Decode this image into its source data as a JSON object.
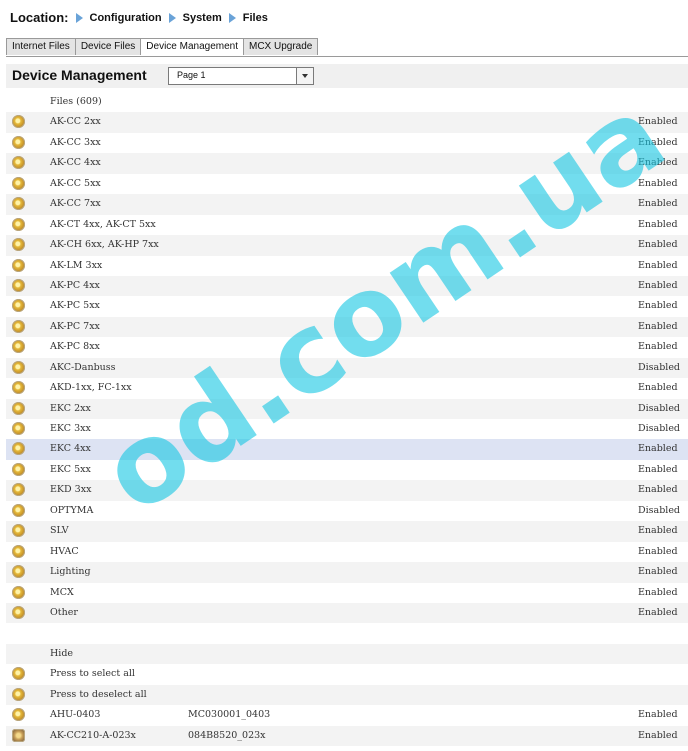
{
  "location": {
    "label": "Location:",
    "crumbs": [
      "Configuration",
      "System",
      "Files"
    ]
  },
  "tabs": [
    {
      "label": "Internet Files",
      "active": false
    },
    {
      "label": "Device Files",
      "active": false
    },
    {
      "label": "Device Management",
      "active": true
    },
    {
      "label": "MCX Upgrade",
      "active": false
    }
  ],
  "header": {
    "title": "Device Management",
    "page_select": "Page 1"
  },
  "rows": [
    {
      "icon": "",
      "name": "Files (609)",
      "code": "",
      "status": ""
    },
    {
      "icon": "gear-icon",
      "name": "AK-CC 2xx",
      "code": "",
      "status": "Enabled"
    },
    {
      "icon": "gear-icon",
      "name": "AK-CC 3xx",
      "code": "",
      "status": "Enabled"
    },
    {
      "icon": "gear-icon",
      "name": "AK-CC 4xx",
      "code": "",
      "status": "Enabled"
    },
    {
      "icon": "gear-icon",
      "name": "AK-CC 5xx",
      "code": "",
      "status": "Enabled"
    },
    {
      "icon": "gear-icon",
      "name": "AK-CC 7xx",
      "code": "",
      "status": "Enabled"
    },
    {
      "icon": "gear-icon",
      "name": "AK-CT 4xx, AK-CT 5xx",
      "code": "",
      "status": "Enabled"
    },
    {
      "icon": "gear-icon",
      "name": "AK-CH 6xx, AK-HP 7xx",
      "code": "",
      "status": "Enabled"
    },
    {
      "icon": "gear-icon",
      "name": "AK-LM 3xx",
      "code": "",
      "status": "Enabled"
    },
    {
      "icon": "gear-icon",
      "name": "AK-PC 4xx",
      "code": "",
      "status": "Enabled"
    },
    {
      "icon": "gear-icon",
      "name": "AK-PC 5xx",
      "code": "",
      "status": "Enabled"
    },
    {
      "icon": "gear-icon",
      "name": "AK-PC 7xx",
      "code": "",
      "status": "Enabled"
    },
    {
      "icon": "gear-icon",
      "name": "AK-PC 8xx",
      "code": "",
      "status": "Enabled"
    },
    {
      "icon": "gear-icon",
      "name": "AKC-Danbuss",
      "code": "",
      "status": "Disabled"
    },
    {
      "icon": "gear-icon",
      "name": "AKD-1xx, FC-1xx",
      "code": "",
      "status": "Enabled"
    },
    {
      "icon": "gear-icon",
      "name": "EKC 2xx",
      "code": "",
      "status": "Disabled"
    },
    {
      "icon": "gear-icon",
      "name": "EKC 3xx",
      "code": "",
      "status": "Disabled"
    },
    {
      "icon": "gear-icon",
      "name": "EKC 4xx",
      "code": "",
      "status": "Enabled",
      "highlight": true
    },
    {
      "icon": "gear-icon",
      "name": "EKC 5xx",
      "code": "",
      "status": "Enabled"
    },
    {
      "icon": "gear-icon",
      "name": "EKD 3xx",
      "code": "",
      "status": "Enabled"
    },
    {
      "icon": "gear-icon",
      "name": "OPTYMA",
      "code": "",
      "status": "Disabled"
    },
    {
      "icon": "gear-icon",
      "name": "SLV",
      "code": "",
      "status": "Enabled"
    },
    {
      "icon": "gear-icon",
      "name": "HVAC",
      "code": "",
      "status": "Enabled"
    },
    {
      "icon": "gear-icon",
      "name": "Lighting",
      "code": "",
      "status": "Enabled"
    },
    {
      "icon": "gear-icon",
      "name": "MCX",
      "code": "",
      "status": "Enabled"
    },
    {
      "icon": "gear-icon",
      "name": "Other",
      "code": "",
      "status": "Enabled"
    },
    {
      "icon": "",
      "name": "",
      "code": "",
      "status": ""
    },
    {
      "icon": "",
      "name": "Hide",
      "code": "",
      "status": ""
    },
    {
      "icon": "select-all-icon",
      "name": "Press to select all",
      "code": "",
      "status": ""
    },
    {
      "icon": "deselect-all-icon",
      "name": "Press to deselect all",
      "code": "",
      "status": ""
    },
    {
      "icon": "gear-icon",
      "name": "AHU-0403",
      "code": "MC030001_0403",
      "status": "Enabled"
    },
    {
      "icon": "module-icon",
      "name": "AK-CC210-A-023x",
      "code": "084B8520_023x",
      "status": "Enabled"
    }
  ],
  "watermark": "od.com.ua"
}
